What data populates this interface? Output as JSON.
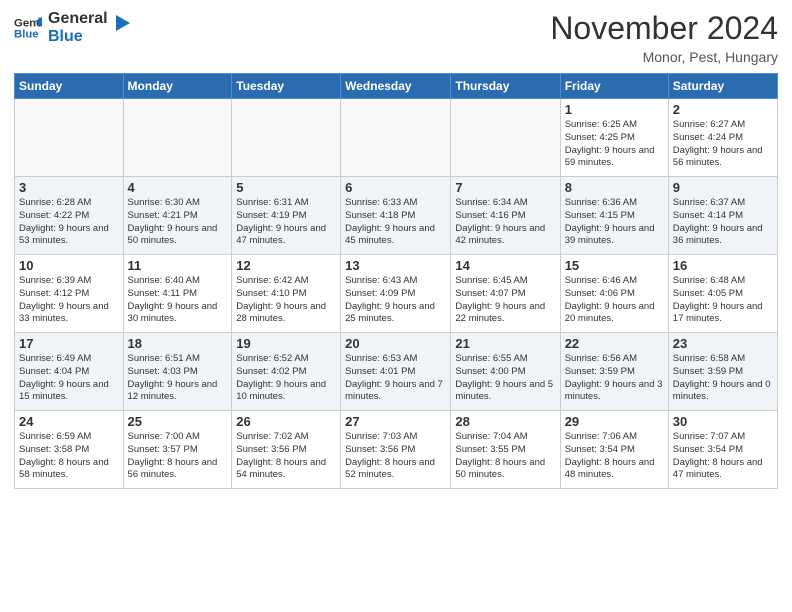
{
  "header": {
    "logo_general": "General",
    "logo_blue": "Blue",
    "month_title": "November 2024",
    "subtitle": "Monor, Pest, Hungary"
  },
  "columns": [
    "Sunday",
    "Monday",
    "Tuesday",
    "Wednesday",
    "Thursday",
    "Friday",
    "Saturday"
  ],
  "weeks": [
    [
      {
        "day": "",
        "info": ""
      },
      {
        "day": "",
        "info": ""
      },
      {
        "day": "",
        "info": ""
      },
      {
        "day": "",
        "info": ""
      },
      {
        "day": "",
        "info": ""
      },
      {
        "day": "1",
        "info": "Sunrise: 6:25 AM\nSunset: 4:25 PM\nDaylight: 9 hours\nand 59 minutes."
      },
      {
        "day": "2",
        "info": "Sunrise: 6:27 AM\nSunset: 4:24 PM\nDaylight: 9 hours\nand 56 minutes."
      }
    ],
    [
      {
        "day": "3",
        "info": "Sunrise: 6:28 AM\nSunset: 4:22 PM\nDaylight: 9 hours\nand 53 minutes."
      },
      {
        "day": "4",
        "info": "Sunrise: 6:30 AM\nSunset: 4:21 PM\nDaylight: 9 hours\nand 50 minutes."
      },
      {
        "day": "5",
        "info": "Sunrise: 6:31 AM\nSunset: 4:19 PM\nDaylight: 9 hours\nand 47 minutes."
      },
      {
        "day": "6",
        "info": "Sunrise: 6:33 AM\nSunset: 4:18 PM\nDaylight: 9 hours\nand 45 minutes."
      },
      {
        "day": "7",
        "info": "Sunrise: 6:34 AM\nSunset: 4:16 PM\nDaylight: 9 hours\nand 42 minutes."
      },
      {
        "day": "8",
        "info": "Sunrise: 6:36 AM\nSunset: 4:15 PM\nDaylight: 9 hours\nand 39 minutes."
      },
      {
        "day": "9",
        "info": "Sunrise: 6:37 AM\nSunset: 4:14 PM\nDaylight: 9 hours\nand 36 minutes."
      }
    ],
    [
      {
        "day": "10",
        "info": "Sunrise: 6:39 AM\nSunset: 4:12 PM\nDaylight: 9 hours\nand 33 minutes."
      },
      {
        "day": "11",
        "info": "Sunrise: 6:40 AM\nSunset: 4:11 PM\nDaylight: 9 hours\nand 30 minutes."
      },
      {
        "day": "12",
        "info": "Sunrise: 6:42 AM\nSunset: 4:10 PM\nDaylight: 9 hours\nand 28 minutes."
      },
      {
        "day": "13",
        "info": "Sunrise: 6:43 AM\nSunset: 4:09 PM\nDaylight: 9 hours\nand 25 minutes."
      },
      {
        "day": "14",
        "info": "Sunrise: 6:45 AM\nSunset: 4:07 PM\nDaylight: 9 hours\nand 22 minutes."
      },
      {
        "day": "15",
        "info": "Sunrise: 6:46 AM\nSunset: 4:06 PM\nDaylight: 9 hours\nand 20 minutes."
      },
      {
        "day": "16",
        "info": "Sunrise: 6:48 AM\nSunset: 4:05 PM\nDaylight: 9 hours\nand 17 minutes."
      }
    ],
    [
      {
        "day": "17",
        "info": "Sunrise: 6:49 AM\nSunset: 4:04 PM\nDaylight: 9 hours\nand 15 minutes."
      },
      {
        "day": "18",
        "info": "Sunrise: 6:51 AM\nSunset: 4:03 PM\nDaylight: 9 hours\nand 12 minutes."
      },
      {
        "day": "19",
        "info": "Sunrise: 6:52 AM\nSunset: 4:02 PM\nDaylight: 9 hours\nand 10 minutes."
      },
      {
        "day": "20",
        "info": "Sunrise: 6:53 AM\nSunset: 4:01 PM\nDaylight: 9 hours\nand 7 minutes."
      },
      {
        "day": "21",
        "info": "Sunrise: 6:55 AM\nSunset: 4:00 PM\nDaylight: 9 hours\nand 5 minutes."
      },
      {
        "day": "22",
        "info": "Sunrise: 6:56 AM\nSunset: 3:59 PM\nDaylight: 9 hours\nand 3 minutes."
      },
      {
        "day": "23",
        "info": "Sunrise: 6:58 AM\nSunset: 3:59 PM\nDaylight: 9 hours\nand 0 minutes."
      }
    ],
    [
      {
        "day": "24",
        "info": "Sunrise: 6:59 AM\nSunset: 3:58 PM\nDaylight: 8 hours\nand 58 minutes."
      },
      {
        "day": "25",
        "info": "Sunrise: 7:00 AM\nSunset: 3:57 PM\nDaylight: 8 hours\nand 56 minutes."
      },
      {
        "day": "26",
        "info": "Sunrise: 7:02 AM\nSunset: 3:56 PM\nDaylight: 8 hours\nand 54 minutes."
      },
      {
        "day": "27",
        "info": "Sunrise: 7:03 AM\nSunset: 3:56 PM\nDaylight: 8 hours\nand 52 minutes."
      },
      {
        "day": "28",
        "info": "Sunrise: 7:04 AM\nSunset: 3:55 PM\nDaylight: 8 hours\nand 50 minutes."
      },
      {
        "day": "29",
        "info": "Sunrise: 7:06 AM\nSunset: 3:54 PM\nDaylight: 8 hours\nand 48 minutes."
      },
      {
        "day": "30",
        "info": "Sunrise: 7:07 AM\nSunset: 3:54 PM\nDaylight: 8 hours\nand 47 minutes."
      }
    ]
  ]
}
